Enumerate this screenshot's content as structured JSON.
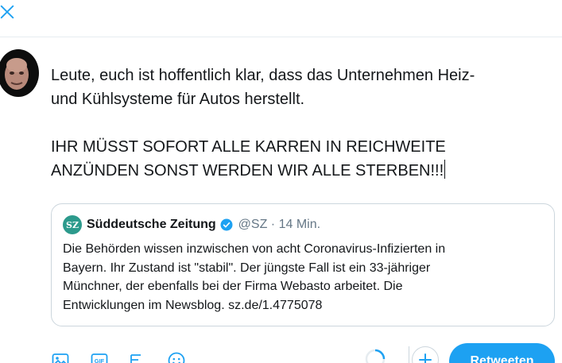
{
  "compose": {
    "paragraph1_line1": "Leute, euch ist hoffentlich klar, dass das Unternehmen Heiz-",
    "paragraph1_line2": "und Kühlsysteme für Autos herstellt.",
    "paragraph2_line1": "IHR MÜSST SOFORT ALLE KARREN IN REICHWEITE",
    "paragraph2_line2": "ANZÜNDEN SONST WERDEN WIR ALLE STERBEN!!!"
  },
  "quote": {
    "logo_text": "SZ",
    "author_name": "Süddeutsche Zeitung",
    "handle_time": "@SZ · 14 Min.",
    "text_line1": "Die Behörden wissen inzwischen von acht Coronavirus-Infizierten in",
    "text_line2": "Bayern. Ihr Zustand ist \"stabil\". Der jüngste Fall ist ein 33-jähriger",
    "text_line3": "Münchner, der ebenfalls bei der Firma Webasto arbeitet. Die",
    "text_line4": "Entwicklungen im Newsblog. sz.de/1.4775078"
  },
  "toolbar": {
    "retweet_label": "Retweeten",
    "icons": [
      "image-icon",
      "gif-icon",
      "poll-icon",
      "emoji-icon",
      "progress-ring-icon",
      "plus-icon"
    ]
  },
  "colors": {
    "accent": "#1da1f2",
    "text": "#14171a",
    "secondary_text": "#657786",
    "border": "#ccd6dd",
    "sz_logo": "#2c9a8c"
  }
}
